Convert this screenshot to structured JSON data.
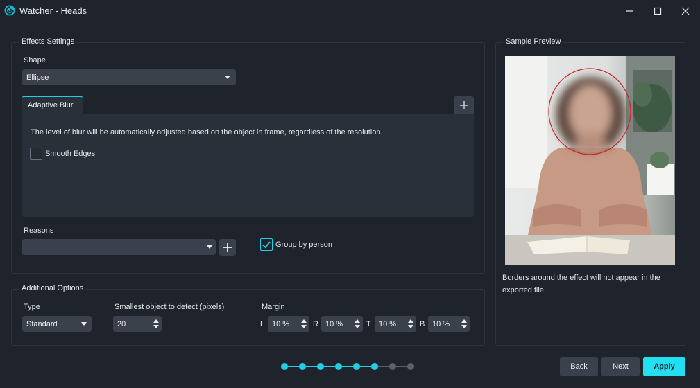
{
  "window": {
    "title": "Watcher - Heads"
  },
  "effects": {
    "legend": "Effects Settings",
    "shape_label": "Shape",
    "shape_value": "Ellipse",
    "tab_label": "Adaptive Blur",
    "description": "The level of blur will be automatically adjusted based on the object in frame, regardless of the resolution.",
    "smooth_edges_label": "Smooth Edges",
    "smooth_edges_checked": false,
    "reasons_label": "Reasons",
    "reasons_value": "",
    "group_by_person_label": "Group by person",
    "group_by_person_checked": true
  },
  "additional": {
    "legend": "Additional Options",
    "type_label": "Type",
    "type_value": "Standard",
    "smallest_label": "Smallest object to detect (pixels)",
    "smallest_value": "20",
    "margin_label": "Margin",
    "margins": [
      {
        "key": "L",
        "value": "10 %"
      },
      {
        "key": "R",
        "value": "10 %"
      },
      {
        "key": "T",
        "value": "10 %"
      },
      {
        "key": "B",
        "value": "10 %"
      }
    ]
  },
  "preview": {
    "legend": "Sample Preview",
    "note": "Borders around the effect will not appear in the exported file.",
    "border_color": "#d01f24"
  },
  "steps": {
    "total": 8,
    "completed": 6
  },
  "buttons": {
    "back": "Back",
    "next": "Next",
    "apply": "Apply"
  },
  "colors": {
    "accent": "#22cde6",
    "primary_button": "#22e0f2"
  }
}
